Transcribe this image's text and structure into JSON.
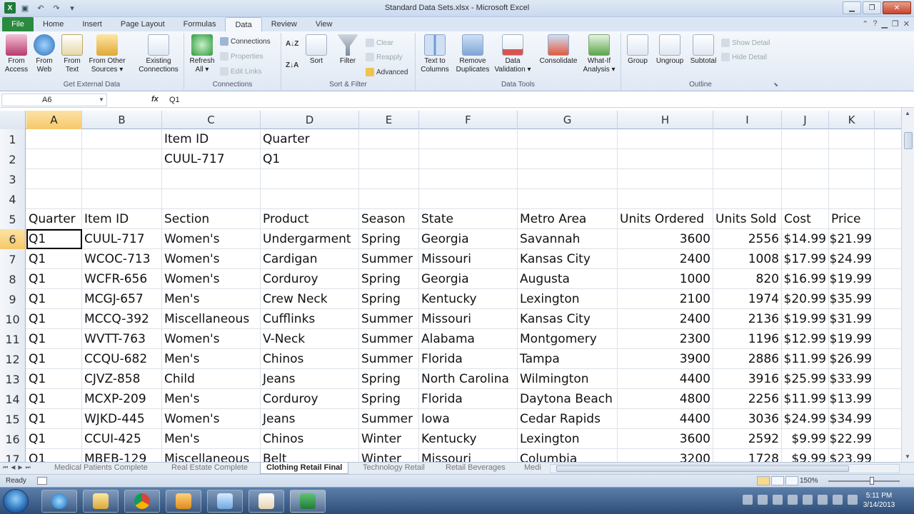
{
  "window": {
    "title": "Standard Data Sets.xlsx - Microsoft Excel"
  },
  "ribbon_tabs": [
    "File",
    "Home",
    "Insert",
    "Page Layout",
    "Formulas",
    "Data",
    "Review",
    "View"
  ],
  "ribbon": {
    "get_external": {
      "label": "Get External Data",
      "from_access": [
        "From",
        "Access"
      ],
      "from_web": [
        "From",
        "Web"
      ],
      "from_text": [
        "From",
        "Text"
      ],
      "from_other": [
        "From Other",
        "Sources ▾"
      ],
      "existing": [
        "Existing",
        "Connections"
      ]
    },
    "connections": {
      "label": "Connections",
      "refresh": [
        "Refresh",
        "All ▾"
      ],
      "connections": "Connections",
      "properties": "Properties",
      "edit_links": "Edit Links"
    },
    "sort_filter": {
      "label": "Sort & Filter",
      "sort": "Sort",
      "filter": "Filter",
      "clear": "Clear",
      "reapply": "Reapply",
      "advanced": "Advanced"
    },
    "data_tools": {
      "label": "Data Tools",
      "text_to_columns": [
        "Text to",
        "Columns"
      ],
      "remove_duplicates": [
        "Remove",
        "Duplicates"
      ],
      "data_validation": [
        "Data",
        "Validation ▾"
      ],
      "consolidate": "Consolidate",
      "what_if": [
        "What-If",
        "Analysis ▾"
      ]
    },
    "outline": {
      "label": "Outline",
      "group": "Group",
      "ungroup": "Ungroup",
      "subtotal": "Subtotal",
      "show_detail": "Show Detail",
      "hide_detail": "Hide Detail"
    }
  },
  "formula_bar": {
    "name_box": "A6",
    "fx": "fx",
    "value": "Q1"
  },
  "columns": [
    {
      "letter": "A",
      "active": true
    },
    {
      "letter": "B"
    },
    {
      "letter": "C"
    },
    {
      "letter": "D"
    },
    {
      "letter": "E"
    },
    {
      "letter": "F"
    },
    {
      "letter": "G"
    },
    {
      "letter": "H"
    },
    {
      "letter": "I"
    },
    {
      "letter": "J"
    },
    {
      "letter": "K"
    }
  ],
  "rows": [
    {
      "num": "1",
      "cells": [
        "",
        "",
        "Item ID",
        "Quarter",
        "",
        "",
        "",
        "",
        "",
        "",
        ""
      ]
    },
    {
      "num": "2",
      "cells": [
        "",
        "",
        "CUUL-717",
        "Q1",
        "",
        "",
        "",
        "",
        "",
        "",
        ""
      ]
    },
    {
      "num": "3",
      "cells": [
        "",
        "",
        "",
        "",
        "",
        "",
        "",
        "",
        "",
        "",
        ""
      ]
    },
    {
      "num": "4",
      "cells": [
        "",
        "",
        "",
        "",
        "",
        "",
        "",
        "",
        "",
        "",
        ""
      ]
    },
    {
      "num": "5",
      "cells": [
        "Quarter",
        "Item ID",
        "Section",
        "Product",
        "Season",
        "State",
        "Metro Area",
        "Units Ordered",
        "Units Sold",
        "Cost",
        "Price"
      ]
    },
    {
      "num": "6",
      "active": true,
      "cells": [
        "Q1",
        "CUUL-717",
        "Women's",
        "Undergarment",
        "Spring",
        "Georgia",
        "Savannah",
        "3600",
        "2556",
        "$14.99",
        "$21.99"
      ]
    },
    {
      "num": "7",
      "cells": [
        "Q1",
        "WCOC-713",
        "Women's",
        "Cardigan",
        "Summer",
        "Missouri",
        "Kansas City",
        "2400",
        "1008",
        "$17.99",
        "$24.99"
      ]
    },
    {
      "num": "8",
      "cells": [
        "Q1",
        "WCFR-656",
        "Women's",
        "Corduroy",
        "Spring",
        "Georgia",
        "Augusta",
        "1000",
        "820",
        "$16.99",
        "$19.99"
      ]
    },
    {
      "num": "9",
      "cells": [
        "Q1",
        "MCGJ-657",
        "Men's",
        "Crew Neck",
        "Spring",
        "Kentucky",
        "Lexington",
        "2100",
        "1974",
        "$20.99",
        "$35.99"
      ]
    },
    {
      "num": "10",
      "cells": [
        "Q1",
        "MCCQ-392",
        "Miscellaneous",
        "Cufflinks",
        "Summer",
        "Missouri",
        "Kansas City",
        "2400",
        "2136",
        "$19.99",
        "$31.99"
      ]
    },
    {
      "num": "11",
      "cells": [
        "Q1",
        "WVTT-763",
        "Women's",
        "V-Neck",
        "Summer",
        "Alabama",
        "Montgomery",
        "2300",
        "1196",
        "$12.99",
        "$19.99"
      ]
    },
    {
      "num": "12",
      "cells": [
        "Q1",
        "CCQU-682",
        "Men's",
        "Chinos",
        "Summer",
        "Florida",
        "Tampa",
        "3900",
        "2886",
        "$11.99",
        "$26.99"
      ]
    },
    {
      "num": "13",
      "cells": [
        "Q1",
        "CJVZ-858",
        "Child",
        "Jeans",
        "Spring",
        "North Carolina",
        "Wilmington",
        "4400",
        "3916",
        "$25.99",
        "$33.99"
      ]
    },
    {
      "num": "14",
      "cells": [
        "Q1",
        "MCXP-209",
        "Men's",
        "Corduroy",
        "Spring",
        "Florida",
        "Daytona Beach",
        "4800",
        "2256",
        "$11.99",
        "$13.99"
      ]
    },
    {
      "num": "15",
      "cells": [
        "Q1",
        "WJKD-445",
        "Women's",
        "Jeans",
        "Summer",
        "Iowa",
        "Cedar Rapids",
        "4400",
        "3036",
        "$24.99",
        "$34.99"
      ]
    },
    {
      "num": "16",
      "cells": [
        "Q1",
        "CCUI-425",
        "Men's",
        "Chinos",
        "Winter",
        "Kentucky",
        "Lexington",
        "3600",
        "2592",
        "$9.99",
        "$22.99"
      ]
    },
    {
      "num": "17",
      "cells": [
        "Q1",
        "MBEB-129",
        "Miscellaneous",
        "Belt",
        "Winter",
        "Missouri",
        "Columbia",
        "3200",
        "1728",
        "$9.99",
        "$23.99"
      ]
    }
  ],
  "sheet_tabs": [
    {
      "label": "Medical Patients Complete"
    },
    {
      "label": "Real Estate Complete"
    },
    {
      "label": "Clothing Retail Final",
      "active": true
    },
    {
      "label": "Technology Retail"
    },
    {
      "label": "Retail Beverages"
    },
    {
      "label": "Medi"
    }
  ],
  "status": {
    "ready": "Ready",
    "zoom": "150%"
  },
  "taskbar": {
    "time": "5:11 PM",
    "date": "3/14/2013"
  },
  "colors": {
    "file_tab": "#2a8a3e",
    "active_header": "#f6c86a",
    "excel_green": "#1f7a3b"
  }
}
